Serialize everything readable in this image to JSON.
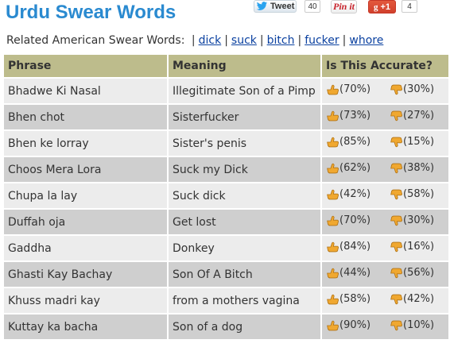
{
  "header": {
    "title": "Urdu Swear Words"
  },
  "share": {
    "tweet_label": "Tweet",
    "tweet_count": "40",
    "pinit_label": "Pin it",
    "gplus_label": "+1",
    "gplus_count": "4"
  },
  "related": {
    "label": "Related American Swear Words:",
    "separator": "|",
    "links": [
      "dick",
      "suck",
      "bitch",
      "fucker",
      "whore"
    ]
  },
  "table": {
    "columns": [
      "Phrase",
      "Meaning",
      "Is This Accurate?"
    ],
    "rows": [
      {
        "phrase": "Bhadwe Ki Nasal",
        "meaning": "Illegitimate Son of a Pimp",
        "yes": "(70%)",
        "no": "(30%)"
      },
      {
        "phrase": "Bhen chot",
        "meaning": "Sisterfucker",
        "yes": "(73%)",
        "no": "(27%)"
      },
      {
        "phrase": "Bhen ke lorray",
        "meaning": "Sister's penis",
        "yes": "(85%)",
        "no": "(15%)"
      },
      {
        "phrase": "Choos Mera Lora",
        "meaning": "Suck my Dick",
        "yes": "(62%)",
        "no": "(38%)"
      },
      {
        "phrase": "Chupa la lay",
        "meaning": "Suck dick",
        "yes": "(42%)",
        "no": "(58%)"
      },
      {
        "phrase": "Duffah oja",
        "meaning": "Get lost",
        "yes": "(70%)",
        "no": "(30%)"
      },
      {
        "phrase": "Gaddha",
        "meaning": "Donkey",
        "yes": "(84%)",
        "no": "(16%)"
      },
      {
        "phrase": "Ghasti Kay Bachay",
        "meaning": "Son Of A Bitch",
        "yes": "(44%)",
        "no": "(56%)"
      },
      {
        "phrase": "Khuss madri kay",
        "meaning": "from a mothers vagina",
        "yes": "(58%)",
        "no": "(42%)"
      },
      {
        "phrase": "Kuttay ka bacha",
        "meaning": "Son of a dog",
        "yes": "(90%)",
        "no": "(10%)"
      }
    ]
  },
  "icons": {
    "thumb_up": "thumbs-up-icon",
    "thumb_down": "thumbs-down-icon",
    "twitter": "twitter-bird-icon"
  },
  "colors": {
    "title": "#2a8ad0",
    "header_bg": "#bdbc8c",
    "row_light": "#ececec",
    "row_dark": "#cfcfcf",
    "link": "#0b41a0",
    "thumb": "#f0a830"
  }
}
